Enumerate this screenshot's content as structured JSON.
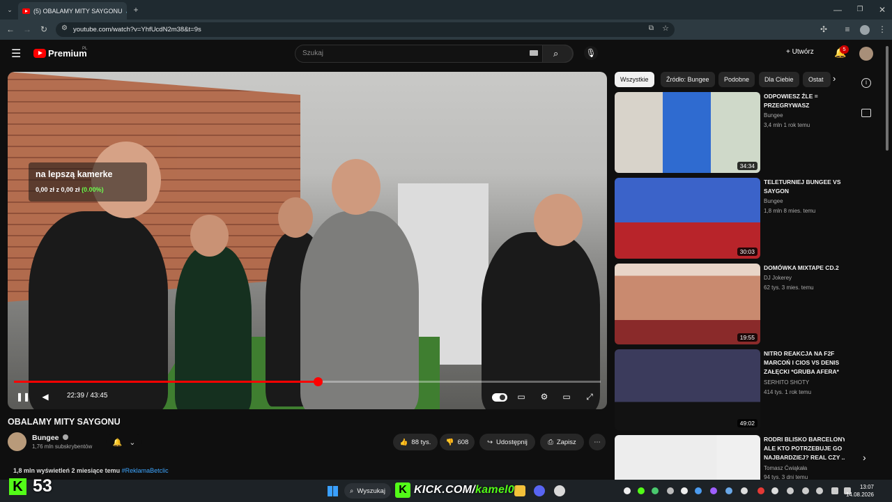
{
  "browser": {
    "tab_title": "(5) OBALAMY MITY SAYGONU",
    "new_tab": "+",
    "url": "youtube.com/watch?v=YhfUcdN2m38&t=9s"
  },
  "header": {
    "logo_text": "Premium",
    "logo_region": "PL",
    "search_placeholder": "Szukaj",
    "create_label": "Utwórz",
    "notification_count": "5"
  },
  "player": {
    "overlay_title": "na lepszą kamerke",
    "overlay_amount": "0,00 zł z 0,00 zł",
    "overlay_pct": "(0.00%)",
    "time": "22:39 / 43:45",
    "progress": 0.518
  },
  "video": {
    "title": "OBALAMY MITY SAYGONU",
    "channel": "Bungee",
    "subscribers": "1,76 mln subskrybentów",
    "likes": "88 tys.",
    "dislikes": "608",
    "share_label": "Udostępnij",
    "save_label": "Zapisz",
    "views_date": "1,8 mln wyświetleń  2 miesiące temu",
    "hashtag": "#ReklamaBetclic"
  },
  "sidebar": {
    "chips": [
      "Wszystkie",
      "Źródło: Bungee",
      "Podobne",
      "Dla Ciebie",
      "Ostat"
    ],
    "recommendations": [
      {
        "title": "ODPOWIESZ ŹLE = PRZEGRYWASZ",
        "channel": "Bungee",
        "meta": "3,4 mln  1 rok temu",
        "duration": "34:34",
        "color": "#e8e2d8"
      },
      {
        "title": "TELETURNIEJ BUNGEE VS SAYGON",
        "channel": "Bungee",
        "meta": "1,8 mln  8 mies. temu",
        "duration": "30:03",
        "color": "#2b4fb8"
      },
      {
        "title": "DOMÓWKA MIXTAPE CD.2",
        "channel": "DJ Jokerey",
        "meta": "62 tys.  3 mies. temu",
        "duration": "19:55",
        "color": "#c84a4a"
      },
      {
        "title": "NITRO REAKCJA NA F2F MARCOŃ I CIOS VS DENIS ZAŁĘCKI *GRUBA AFERA*",
        "channel": "SERHITO SHOTY",
        "meta": "414 tys.  1 rok temu",
        "duration": "49:02",
        "color": "#3a3a5a"
      },
      {
        "title": "RODRI BLISKO BARCELONY, ALE KTO POTRZEBUJE GO NAJBARDZIEJ? REAL CZY ...",
        "channel": "Tomasz Ćwiąkała",
        "meta": "94 tys.  3 dni temu",
        "duration": "",
        "color": "#d9d9d9"
      }
    ]
  },
  "taskbar": {
    "search_label": "Wyszukaj",
    "time": "13:07",
    "date": "14.08.2026"
  },
  "stream_overlay": {
    "kick_count": "53",
    "kick_letter": "K",
    "kick_url": "KICK.COM/",
    "kick_user": "kamel0"
  }
}
